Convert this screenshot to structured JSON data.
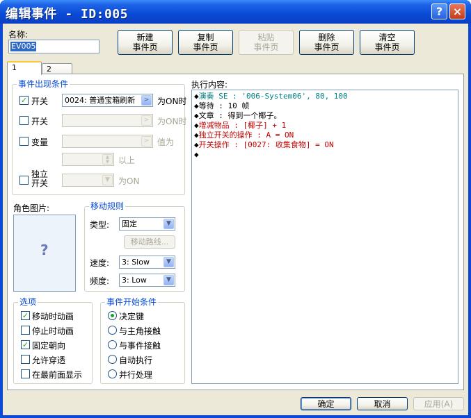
{
  "window": {
    "title": "编辑事件 - ID:005",
    "help_glyph": "?",
    "close_glyph": "×"
  },
  "name_label": "名称:",
  "name_value": "EV005",
  "page_buttons": {
    "new": [
      "新建",
      "事件页"
    ],
    "copy": [
      "复制",
      "事件页"
    ],
    "paste": [
      "粘贴",
      "事件页"
    ],
    "delete": [
      "删除",
      "事件页"
    ],
    "clear": [
      "清空",
      "事件页"
    ]
  },
  "tabs": [
    "1",
    "2"
  ],
  "conditions": {
    "title": "事件出现条件",
    "switch1": {
      "label": "开关",
      "checked": true,
      "value": "0024: 普通宝箱刷新",
      "suffix": "为ON时"
    },
    "switch2": {
      "label": "开关",
      "checked": false,
      "value": "",
      "suffix": "为ON时"
    },
    "variable": {
      "label": "变量",
      "checked": false,
      "value": "",
      "suffix": "值为",
      "amount": "",
      "amount_suffix": "以上"
    },
    "self_switch": {
      "label_line1": "独立",
      "label_line2": "开关",
      "checked": false,
      "value": "",
      "suffix": "为ON"
    }
  },
  "graphic": {
    "label": "角色图片:",
    "placeholder_glyph": "?"
  },
  "movement": {
    "title": "移动规则",
    "type_label": "类型:",
    "type_value": "固定",
    "route_button": "移动路线...",
    "speed_label": "速度:",
    "speed_value": "3: Slow",
    "freq_label": "频度:",
    "freq_value": "3: Low"
  },
  "options": {
    "title": "选项",
    "items": [
      {
        "label": "移动时动画",
        "checked": true
      },
      {
        "label": "停止时动画",
        "checked": false
      },
      {
        "label": "固定朝向",
        "checked": true
      },
      {
        "label": "允许穿透",
        "checked": false
      },
      {
        "label": "在最前面显示",
        "checked": false
      }
    ]
  },
  "trigger": {
    "title": "事件开始条件",
    "items": [
      {
        "label": "决定键",
        "selected": true
      },
      {
        "label": "与主角接触",
        "selected": false
      },
      {
        "label": "与事件接触",
        "selected": false
      },
      {
        "label": "自动执行",
        "selected": false
      },
      {
        "label": "并行处理",
        "selected": false
      }
    ]
  },
  "contents": {
    "label": "执行内容:",
    "lines": [
      {
        "marker": "◆",
        "text": "演奏 SE : '006-System06', 80, 100",
        "color": "#008080"
      },
      {
        "marker": "◆",
        "text": "等待 : 10 帧",
        "color": "#000000"
      },
      {
        "marker": "◆",
        "text": "文章 : 得到一个椰子。",
        "color": "#000000"
      },
      {
        "marker": "◆",
        "text": "增减物品 : [椰子] + 1",
        "color": "#c00000"
      },
      {
        "marker": "◆",
        "text": "独立开关的操作 : A = ON",
        "color": "#c00000"
      },
      {
        "marker": "◆",
        "text": "开关操作 : [0027: 收集食物] = ON",
        "color": "#c00000"
      },
      {
        "marker": "◆",
        "text": "",
        "color": "#000000"
      }
    ]
  },
  "footer": {
    "ok": "确定",
    "cancel": "取消",
    "apply": "应用(A)"
  },
  "colors": {
    "titlebar": "#0a4ad6",
    "client": "#ece9d8",
    "group_title": "#0046d5"
  }
}
